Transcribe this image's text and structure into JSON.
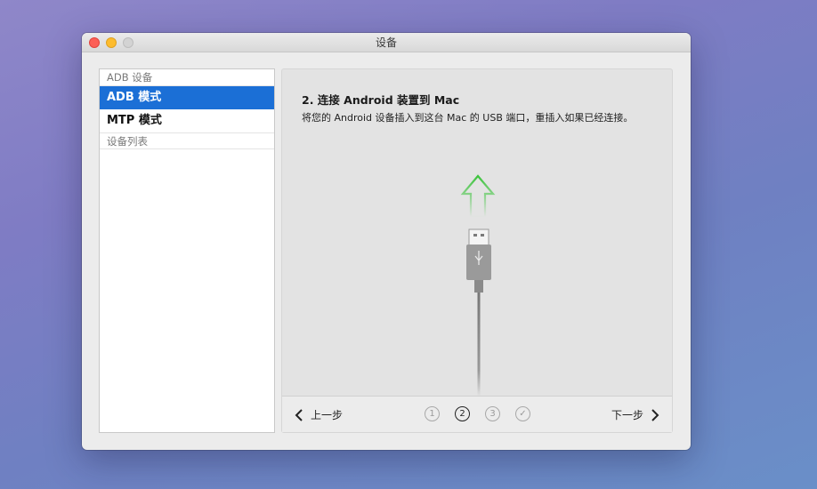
{
  "window": {
    "title": "设备"
  },
  "sidebar": {
    "section1": "ADB 设备",
    "items": [
      {
        "label": "ADB 模式",
        "selected": true
      },
      {
        "label": "MTP 模式",
        "selected": false
      }
    ],
    "section2": "设备列表"
  },
  "main": {
    "step_title": "2. 连接 Android 装置到 Mac",
    "step_desc": "将您的 Android 设备插入到这台 Mac 的 USB 端口，重插入如果已经连接。"
  },
  "footer": {
    "prev_label": "上一步",
    "next_label": "下一步",
    "steps": [
      "1",
      "2",
      "3",
      "✓"
    ],
    "current_step": 2
  },
  "colors": {
    "accent": "#1b6fd6",
    "arrow": "#3cc43c"
  },
  "icons": [
    "close-icon",
    "minimize-icon",
    "maximize-icon",
    "upload-arrow-icon",
    "usb-cable-icon",
    "chevron-left-icon",
    "chevron-right-icon"
  ]
}
